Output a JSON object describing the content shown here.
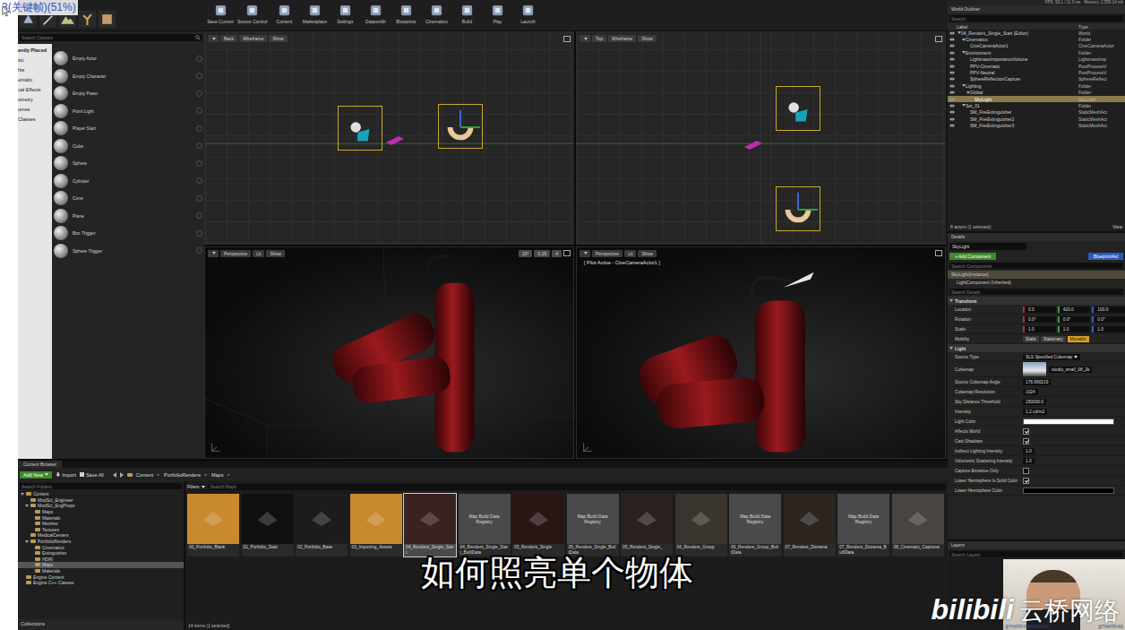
{
  "overlay_title": "3(关键帧)(51%)",
  "stats": {
    "fps": "FPS: 59.1 / 11.3 ms",
    "memory": "Memory: 2,556.14 mb"
  },
  "toolbar": [
    {
      "label": "Save Current"
    },
    {
      "label": "Source Control"
    },
    {
      "label": "Content"
    },
    {
      "label": "Marketplace"
    },
    {
      "label": "Settings"
    },
    {
      "label": "Datasmith"
    },
    {
      "label": "Blueprints"
    },
    {
      "label": "Cinematics"
    },
    {
      "label": "Build"
    },
    {
      "label": "Play"
    },
    {
      "label": "Launch"
    }
  ],
  "place": {
    "search_placeholder": "Search Classes",
    "categories": [
      {
        "label": "ently Placed",
        "selected": true
      },
      {
        "label": "sic",
        "selected": false
      },
      {
        "label": "hts",
        "selected": false
      },
      {
        "label": "ematic",
        "selected": false
      },
      {
        "label": "ual Effects",
        "selected": false
      },
      {
        "label": "ometry",
        "selected": false
      },
      {
        "label": "umes",
        "selected": false
      },
      {
        "label": "Classes",
        "selected": false
      }
    ],
    "items": [
      "Empty Actor",
      "Empty Character",
      "Empty Pawn",
      "Point Light",
      "Player Start",
      "Cube",
      "Sphere",
      "Cylinder",
      "Cone",
      "Plane",
      "Box Trigger",
      "Sphere Trigger"
    ]
  },
  "viewports": [
    {
      "view": "Back",
      "mode": "Wireframe",
      "show": "Show",
      "kind": "wire"
    },
    {
      "view": "Top",
      "mode": "Wireframe",
      "show": "Show",
      "kind": "wire"
    },
    {
      "view": "Perspective",
      "mode": "Lit",
      "show": "Show",
      "kind": "render",
      "snaps": [
        "10°",
        "0.25",
        "4"
      ]
    },
    {
      "view": "Perspective",
      "mode": "Lit",
      "show": "Show",
      "kind": "render",
      "pilot": "[ Pilot Active - CineCameraActor1 ]"
    }
  ],
  "content_browser": {
    "tab": "Content Browser",
    "add_new": "Add New",
    "import": "Import",
    "save_all": "Save All",
    "path": [
      "Content",
      "PortfolioRenders",
      "Maps"
    ],
    "separator": "►",
    "folder_search": "Search Folders",
    "filters": "Filters",
    "asset_search": "Search Maps",
    "folders": [
      {
        "label": "Content",
        "selected": false,
        "expanded": true,
        "children": [
          {
            "label": "ModSci_Engineer",
            "selected": false
          },
          {
            "label": "ModSci_EngProps",
            "selected": false,
            "expanded": true,
            "children": [
              {
                "label": "Maps",
                "selected": false
              },
              {
                "label": "Materials",
                "selected": false
              },
              {
                "label": "Meshes",
                "selected": false
              },
              {
                "label": "Textures",
                "selected": false
              }
            ]
          },
          {
            "label": "MedicalCenters",
            "selected": false
          },
          {
            "label": "PortfolioRenders",
            "selected": false,
            "expanded": true,
            "children": [
              {
                "label": "Cinematics",
                "selected": false
              },
              {
                "label": "Extinguisher",
                "selected": false
              },
              {
                "label": "HDRI",
                "selected": false
              },
              {
                "label": "Maps",
                "selected": true
              },
              {
                "label": "Materials",
                "selected": false
              }
            ]
          }
        ]
      },
      {
        "label": "Engine Content",
        "selected": false
      },
      {
        "label": "Engine C++ Classes",
        "selected": false
      }
    ],
    "collections": "Collections",
    "assets": [
      {
        "label": "00_Portfolio_Blank",
        "kind": "map",
        "selected": false,
        "color": "#c9892f"
      },
      {
        "label": "01_Portfolio_Start",
        "kind": "map",
        "selected": false,
        "color": "#101010"
      },
      {
        "label": "02_Portfolio_Base",
        "kind": "map",
        "selected": false,
        "color": "#1c1c1c"
      },
      {
        "label": "03_Importing_Assets",
        "kind": "map",
        "selected": false,
        "color": "#c9892f"
      },
      {
        "label": "04_Renders_Single_Start",
        "kind": "map",
        "selected": true,
        "color": "#3a2222"
      },
      {
        "label": "04_Renders_Single_Start_BuiltData",
        "kind": "registry",
        "selected": false,
        "caption": "Map Build Data Registry"
      },
      {
        "label": "05_Renders_Single",
        "kind": "map",
        "selected": false,
        "color": "#2a1515"
      },
      {
        "label": "05_Renders_Single_BuiltData",
        "kind": "registry",
        "selected": false,
        "caption": "Map Build Data Registry"
      },
      {
        "label": "05_Renders_Single_",
        "kind": "map",
        "selected": false,
        "color": "#2b2020"
      },
      {
        "label": "06_Renders_Group",
        "kind": "map",
        "selected": false,
        "color": "#3b3530"
      },
      {
        "label": "06_Renders_Group_BuiltData",
        "kind": "registry",
        "selected": false,
        "caption": "Map Build Data Registry"
      },
      {
        "label": "07_Renders_Diorama",
        "kind": "map",
        "selected": false,
        "color": "#2c2520"
      },
      {
        "label": "07_Renders_Diorama_BuiltData",
        "kind": "registry",
        "selected": false,
        "caption": "Map Build Data Registry"
      },
      {
        "label": "08_Cinematic_Captures",
        "kind": "map",
        "selected": false,
        "color": "#4a4440"
      }
    ],
    "footer": "14 items (1 selected)"
  },
  "outliner": {
    "tab": "World Outliner",
    "search_placeholder": "Search...",
    "columns": [
      "Label",
      "Type"
    ],
    "tree": [
      {
        "label": "04_Renders_Single_Start (Editor)",
        "type": "World",
        "selected": false,
        "visible": true,
        "expanded": true,
        "children": [
          {
            "label": "Cinematics",
            "type": "Folder",
            "selected": false,
            "visible": true,
            "expanded": true,
            "children": [
              {
                "label": "CineCameraActor1",
                "type": "CineCameraActor",
                "selected": false,
                "visible": true
              }
            ]
          },
          {
            "label": "Environment",
            "type": "Folder",
            "selected": false,
            "visible": true,
            "expanded": true,
            "children": [
              {
                "label": "LightmassImportanceVolume",
                "type": "LightmassImp",
                "selected": false,
                "visible": true
              },
              {
                "label": "PPV-Cinematic",
                "type": "PostProcessV",
                "selected": false,
                "visible": true
              },
              {
                "label": "PPV-Neutral",
                "type": "PostProcessV",
                "selected": false,
                "visible": true
              },
              {
                "label": "SphereReflectionCapture",
                "type": "SphereReflect",
                "selected": false,
                "visible": true
              }
            ]
          },
          {
            "label": "Lighting",
            "type": "Folder",
            "selected": false,
            "visible": true,
            "expanded": true,
            "children": [
              {
                "label": "Global",
                "type": "Folder",
                "selected": false,
                "visible": true,
                "expanded": true,
                "children": [
                  {
                    "label": "SkyLight",
                    "type": "SkyLight",
                    "selected": true,
                    "visible": true
                  }
                ]
              }
            ]
          },
          {
            "label": "Set_01",
            "type": "Folder",
            "selected": false,
            "visible": true,
            "expanded": true,
            "children": [
              {
                "label": "SM_FireExtinguisher",
                "type": "StaticMeshAct",
                "selected": false,
                "visible": true
              },
              {
                "label": "SM_FireExtinguisher2",
                "type": "StaticMeshAct",
                "selected": false,
                "visible": true
              },
              {
                "label": "SM_FireExtinguisher3",
                "type": "StaticMeshAct",
                "selected": false,
                "visible": true
              }
            ]
          }
        ]
      }
    ],
    "footer": "8 actors (1 selected)",
    "view_options": "View"
  },
  "details": {
    "tab": "Details",
    "name": "SkyLight",
    "add_component": "+ Add Component",
    "blueprint": "Blueprint/Ad",
    "search_components": "Search Components",
    "components": [
      "SkyLight(Instance)",
      "LightComponent (Inherited)"
    ],
    "search_details": "Search Details",
    "sections": [
      {
        "title": "Transform",
        "rows": [
          {
            "label": "Location",
            "kind": "vec3",
            "values": [
              "0.0",
              "420.0",
              "100.0"
            ]
          },
          {
            "label": "Rotation",
            "kind": "vec3",
            "values": [
              "0.0°",
              "0.0°",
              "0.0°"
            ]
          },
          {
            "label": "Scale",
            "kind": "vec3",
            "values": [
              "1.0",
              "1.0",
              "1.0"
            ]
          },
          {
            "label": "Mobility",
            "kind": "mobility",
            "options": [
              {
                "label": "Static",
                "selected": false
              },
              {
                "label": "Stationary",
                "selected": false
              },
              {
                "label": "Movable",
                "selected": true
              }
            ]
          }
        ]
      },
      {
        "title": "Light",
        "rows": [
          {
            "label": "Source Type",
            "kind": "select",
            "value": "SLS Specified Cubemap"
          },
          {
            "label": "Cubemap",
            "kind": "asset",
            "value": "studio_small_08_2k"
          },
          {
            "label": "Source Cubemap Angle",
            "kind": "number",
            "value": "176.990219"
          },
          {
            "label": "Cubemap Resolution",
            "kind": "number",
            "value": "1024"
          },
          {
            "label": "Sky Distance Threshold",
            "kind": "number",
            "value": "150000.0"
          },
          {
            "label": "Intensity",
            "kind": "number",
            "value": "1.2 cd/m2"
          },
          {
            "label": "Light Color",
            "kind": "color",
            "color": "#ffffff"
          },
          {
            "label": "Affects World",
            "kind": "check",
            "checked": true
          },
          {
            "label": "Cast Shadows",
            "kind": "check",
            "checked": true
          },
          {
            "label": "Indirect Lighting Intensity",
            "kind": "number",
            "value": "1.0"
          },
          {
            "label": "Volumetric Scattering Intensity",
            "kind": "number",
            "value": "1.0"
          },
          {
            "label": "Capture Emissive Only",
            "kind": "check",
            "checked": false
          },
          {
            "label": "Lower Hemisphere Is Solid Color",
            "kind": "check",
            "checked": true
          },
          {
            "label": "Lower Hemisphere Color",
            "kind": "color",
            "color": "#000000"
          }
        ]
      }
    ]
  },
  "layers": {
    "tab": "Layers",
    "search_placeholder": "Search Layers"
  },
  "webcam": {
    "handles": [
      "@THATRYANMANNING",
      "@THATRYAN"
    ]
  },
  "subtitle": "如何照亮单个物体",
  "watermark": {
    "logo": "bilibili",
    "brand": "云桥网络"
  }
}
